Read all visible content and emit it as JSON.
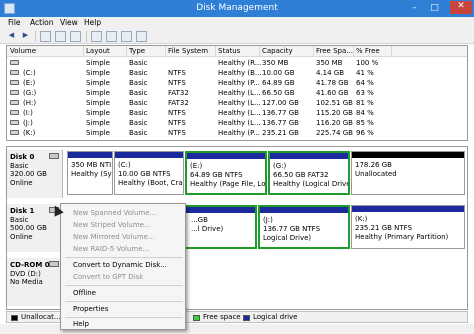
{
  "window": {
    "title": "Disk Management",
    "minimize": "–",
    "maximize": "□",
    "close": "✕"
  },
  "menu": [
    "File",
    "Action",
    "View",
    "Help"
  ],
  "toolbar": {
    "back": "◀",
    "forward": "▶"
  },
  "volumes": {
    "columns": [
      "Volume",
      "Layout",
      "Type",
      "File System",
      "Status",
      "Capacity",
      "Free Spa...",
      "% Free"
    ],
    "rows": [
      [
        "",
        "Simple",
        "Basic",
        "",
        "Healthy (R...",
        "350 MB",
        "350 MB",
        "100 %"
      ],
      [
        "(C:)",
        "Simple",
        "Basic",
        "NTFS",
        "Healthy (B...",
        "10.00 GB",
        "4.14 GB",
        "41 %"
      ],
      [
        "(E:)",
        "Simple",
        "Basic",
        "NTFS",
        "Healthy (P...",
        "64.89 GB",
        "41.78 GB",
        "64 %"
      ],
      [
        "(G:)",
        "Simple",
        "Basic",
        "FAT32",
        "Healthy (L...",
        "66.50 GB",
        "41.60 GB",
        "63 %"
      ],
      [
        "(H:)",
        "Simple",
        "Basic",
        "FAT32",
        "Healthy (L...",
        "127.00 GB",
        "102.51 GB",
        "81 %"
      ],
      [
        "(I:)",
        "Simple",
        "Basic",
        "NTFS",
        "Healthy (L...",
        "136.77 GB",
        "115.20 GB",
        "84 %"
      ],
      [
        "(J:)",
        "Simple",
        "Basic",
        "NTFS",
        "Healthy (L...",
        "136.77 GB",
        "116.20 GB",
        "85 %"
      ],
      [
        "(K:)",
        "Simple",
        "Basic",
        "NTFS",
        "Healthy (P...",
        "235.21 GB",
        "225.74 GB",
        "96 %"
      ]
    ]
  },
  "disks": [
    {
      "name": "Disk 0",
      "type": "Basic",
      "size": "320.00 GB",
      "status": "Online",
      "partitions": [
        {
          "l1": "",
          "l2": "350 MB NTI",
          "l3": "Healthy (Sy"
        },
        {
          "l1": "(C:)",
          "l2": "10.00 GB NTFS",
          "l3": "Healthy (Boot, Crasl"
        },
        {
          "l1": "(E:)",
          "l2": "64.89 GB NTFS",
          "l3": "Healthy (Page File, Logic"
        },
        {
          "l1": "(G:)",
          "l2": "66.50 GB FAT32",
          "l3": "Healthy (Logical Drive)"
        },
        {
          "l1": "",
          "l2": "178.26 GB",
          "l3": "Unallocated"
        }
      ]
    },
    {
      "name": "Disk 1",
      "type": "Basic",
      "size": "500.00 GB",
      "status": "Online",
      "partitions": [
        {
          "l1": "",
          "l2": "...GB",
          "l3": "...l Drive)"
        },
        {
          "l1": "(J:)",
          "l2": "136.77 GB NTFS",
          "l3": "Logical Drive)"
        },
        {
          "l1": "(K:)",
          "l2": "235.21 GB NTFS",
          "l3": "Healthy (Primary Partition)"
        }
      ]
    },
    {
      "name": "CD-ROM 0",
      "type": "DVD (D:)",
      "size": "",
      "status": "No Media"
    }
  ],
  "legend": {
    "unallocated": "Unallocat...",
    "free_space": "Free space",
    "logical_drive": "Logical drive"
  },
  "context_menu": {
    "new_spanned": "New Spanned Volume...",
    "new_striped": "New Striped Volume...",
    "new_mirrored": "New Mirrored Volume...",
    "new_raid5": "New RAID-5 Volume...",
    "convert_dynamic": "Convert to Dynamic Disk...",
    "convert_gpt": "Convert to GPT Disk",
    "offline": "Offline",
    "properties": "Properties",
    "help": "Help"
  },
  "colors": {
    "title_bar": "#2f7fd6",
    "primary_partition": "#1b2a9c",
    "logical_drive": "#1b2a9c",
    "free_space": "#3dd13d",
    "selection": "#1f9c2a"
  }
}
